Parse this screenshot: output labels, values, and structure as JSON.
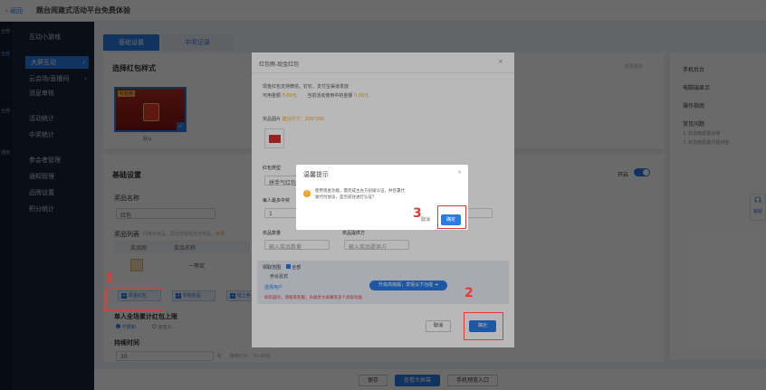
{
  "topbar": {
    "back": "返回",
    "title": "题台阅建式活动平台免费体验"
  },
  "leftnav": {
    "group_labels": [
      "全部",
      "全部",
      "全部",
      "通用"
    ],
    "items": [
      {
        "label": "互动小游戏",
        "active": false
      },
      {
        "label": "大屏互动",
        "active": true
      },
      {
        "label": "云会场/直播间",
        "active": false
      },
      {
        "label": "消息审核",
        "active": false
      },
      {
        "label": "活动统计",
        "active": false
      },
      {
        "label": "中奖统计",
        "active": false
      },
      {
        "label": "参会者管理",
        "active": false
      },
      {
        "label": "通知管理",
        "active": false
      },
      {
        "label": "品牌设置",
        "active": false
      },
      {
        "label": "积分统计",
        "active": false
      }
    ]
  },
  "tabs": [
    "基础设置",
    "中奖记录"
  ],
  "main": {
    "select_style_title": "选择红包样式",
    "style_thumb_label": "默认",
    "style_thumb_badge": "红包雨",
    "basic_title": "基础设置",
    "open_label": "开启",
    "prize_name_label": "奖品名称",
    "prize_name_value": "红包",
    "prize_list_label": "奖品列表",
    "prize_list_hint": "同类中奖品，同位奖励优先开奖品，",
    "prize_list_hint_red": "奖项",
    "prize_col_headers": [
      "奖品图",
      "奖品名称"
    ],
    "prize_row_name": "一等奖",
    "add_buttons": [
      "现金红包",
      "实物奖品",
      "线上券"
    ],
    "limit_title": "单人全场累计红包上限",
    "limit_opts": [
      "不限制",
      "自定义"
    ],
    "duration_title": "持续时间",
    "duration_value": "30",
    "duration_unit": "秒",
    "duration_hint": "推荐时长：30-60秒"
  },
  "right_panel": {
    "items": [
      "手机后台",
      "电脑端显示",
      "操作指南",
      "常见问题"
    ],
    "subitems": [
      "1. 红包雨配置说明",
      "2. 红包雨配置问题排查"
    ],
    "top_link": "查看更多"
  },
  "side_float": {
    "label": "客服"
  },
  "bottom_bar": {
    "buttons": [
      "保存",
      "查看大屏幕",
      "手机预览入口"
    ]
  },
  "redpacket_modal": {
    "title": "红包雨-现金红包",
    "desc_line1": "现金红包支持微信、钉钉、支付宝渠道发放",
    "available_label": "可用金额",
    "available_value": "0.00元",
    "used_label": "当前活动使用中的金额",
    "used_value": "0.00元",
    "img_label": "奖品图片",
    "img_hint": "建议尺寸：200*200",
    "type_label": "红包类型",
    "type_value": "拼手气红包",
    "per_label": "每人最多中奖",
    "per_value": "1",
    "count_label": "奖品数量",
    "count_placeholder": "输入奖品数量",
    "amount_label": "奖品提供方",
    "amount_placeholder": "输入奖品提供方",
    "scope_label": "领取范围",
    "scope_all": "全部",
    "scope_sub": "参会嘉宾",
    "scope_select": "选择用户",
    "upgrade_btn": "升级高级版，享受以下功能",
    "note": "如有疑问，请联系客服，升级享大屏幕等多个高级功能",
    "cancel": "取消",
    "confirm": "确定"
  },
  "dialog": {
    "title": "温馨提示",
    "close": "×",
    "message": "使用现金功能，需完成主办方初级认证，并签署代收代付协议，是否前往进行认证？",
    "cancel": "取消",
    "confirm": "确定"
  },
  "annotations": [
    "1",
    "2",
    "3"
  ],
  "colors": {
    "accent": "#2a7be4",
    "nav_bg": "#1b2436",
    "annotation": "#e53935"
  }
}
